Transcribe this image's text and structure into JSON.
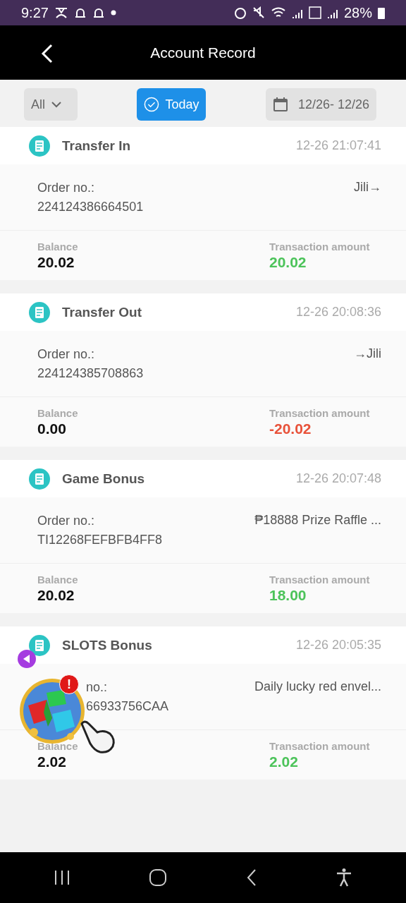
{
  "status_bar": {
    "time": "9:27",
    "battery": "28%"
  },
  "header": {
    "title": "Account Record"
  },
  "filters": {
    "type": {
      "value": "All"
    },
    "today": {
      "label": "Today",
      "selected": true
    },
    "date_range": {
      "value": "12/26- 12/26"
    }
  },
  "records": [
    {
      "title": "Transfer In",
      "time": "12-26 21:07:41",
      "order_label": "Order no.:",
      "order_no": "224124386664501",
      "detail": "Jili→",
      "balance_label": "Balance",
      "balance": "20.02",
      "amount_label": "Transaction amount",
      "amount": "20.02",
      "color": "#4cc35a"
    },
    {
      "title": "Transfer Out",
      "time": "12-26 20:08:36",
      "order_label": "Order no.:",
      "order_no": "224124385708863",
      "detail": "→Jili",
      "balance_label": "Balance",
      "balance": "0.00",
      "amount_label": "Transaction amount",
      "amount": "-20.02",
      "color": "#e8523a"
    },
    {
      "title": "Game Bonus",
      "time": "12-26 20:07:48",
      "order_label": "Order no.:",
      "order_no": "TI12268FEFBFB4FF8",
      "detail": "₱18888 Prize Raffle ...",
      "balance_label": "Balance",
      "balance": "20.02",
      "amount_label": "Transaction amount",
      "amount": "18.00",
      "color": "#4cc35a"
    },
    {
      "title": "SLOTS Bonus",
      "time": "12-26 20:05:35",
      "order_label": "no.:",
      "order_no": "66933756CAA",
      "detail": "Daily lucky red envel...",
      "balance_label": "Balance",
      "balance": "2.02",
      "amount_label": "Transaction amount",
      "amount": "2.02",
      "color": "#4cc35a"
    }
  ],
  "floating_widget": {
    "kind": "picture",
    "alert": "!"
  }
}
